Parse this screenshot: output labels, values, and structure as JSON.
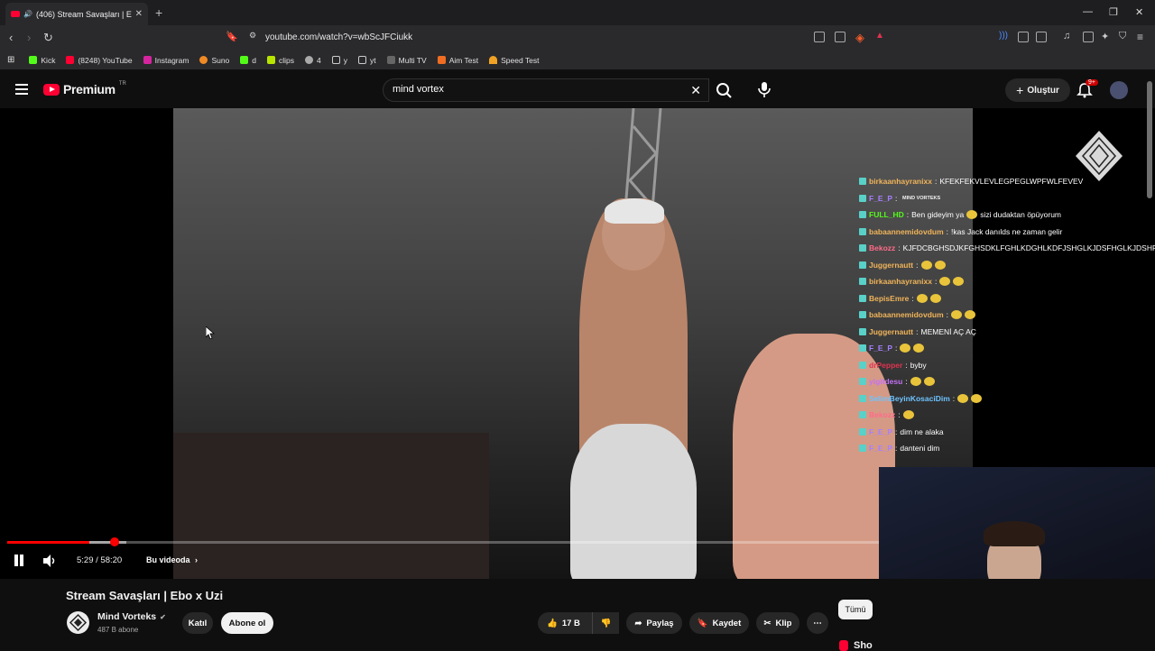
{
  "browser": {
    "tab_title": "(406) Stream Savaşları | Ebo x",
    "url": "youtube.com/watch?v=wbScJFCiukk",
    "bookmarks": [
      {
        "label": "Kick",
        "color": "#53fc18"
      },
      {
        "label": "(8248) YouTube",
        "color": "#ff0033"
      },
      {
        "label": "Instagram",
        "color": "#d6249f"
      },
      {
        "label": "Suno",
        "color": "#f08a24"
      },
      {
        "label": "d",
        "color": "#53fc18"
      },
      {
        "label": "clips",
        "color": "#b7e500"
      },
      {
        "label": "4",
        "color": "#aaaaaa"
      },
      {
        "label": "y",
        "color": "#aaaaaa"
      },
      {
        "label": "yt",
        "color": "#aaaaaa"
      },
      {
        "label": "Multi TV",
        "color": "#888888"
      },
      {
        "label": "Aim Test",
        "color": "#f06d22"
      },
      {
        "label": "Speed Test",
        "color": "#f0a224"
      }
    ]
  },
  "youtube": {
    "logo_text": "Premium",
    "country": "TR",
    "search_value": "mind vortex",
    "create_label": "Oluştur",
    "notif_badge": "9+"
  },
  "player": {
    "time": "5:29 / 58:20",
    "chapter_label": "Bu videoda",
    "progress_fraction": 0.094,
    "overlay_logo_text": "MIND VORTEKS"
  },
  "chat": [
    {
      "user": "birkaanhayranixx",
      "color": "#f0b45a",
      "text": "KFEKFEKVLEVLEGPEGLWPFWLFEVEV",
      "emojis": 0
    },
    {
      "user": "F_E_P",
      "color": "#a67fff",
      "text": "",
      "emojis": 0
    },
    {
      "user": "FULL_HD",
      "color": "#53fc18",
      "text": "Ben gideyim ya",
      "emojis": 1,
      "text2": "sizi dudaktan öpüyorum"
    },
    {
      "user": "babaannemidovdum",
      "color": "#f0b45a",
      "text": "!kas Jack danılds ne zaman gelir",
      "emojis": 0
    },
    {
      "user": "Bekozz",
      "color": "#ff6b8a",
      "text": "KJFDCBGHSDJKFGHSDKLFGHLKDGHLKDFJSHGLKJDSFHGLKJDSHF",
      "emojis": 0
    },
    {
      "user": "Juggernautt",
      "color": "#f0b45a",
      "text": "",
      "emojis": 2
    },
    {
      "user": "birkaanhayranixx",
      "color": "#f0b45a",
      "text": "",
      "emojis": 2
    },
    {
      "user": "BepisEmre",
      "color": "#f0b45a",
      "text": "",
      "emojis": 2
    },
    {
      "user": "babaannemidovdum",
      "color": "#f0b45a",
      "text": "",
      "emojis": 2
    },
    {
      "user": "Juggernautt",
      "color": "#f0b45a",
      "text": "MEMENİ AÇ AÇ",
      "emojis": 0
    },
    {
      "user": "F_E_P",
      "color": "#a67fff",
      "text": "",
      "emojis": 2
    },
    {
      "user": "drPepper",
      "color": "#e0334f",
      "text": "byby",
      "emojis": 0
    },
    {
      "user": "yigitdesu",
      "color": "#c471f5",
      "text": "",
      "emojis": 2
    },
    {
      "user": "SelimBeyinKosaciDim",
      "color": "#6ec3ff",
      "text": "",
      "emojis": 2
    },
    {
      "user": "Bekozz",
      "color": "#ff6b8a",
      "text": "",
      "emojis": 1
    },
    {
      "user": "F_E_P",
      "color": "#a67fff",
      "text": "dim ne alaka",
      "emojis": 0
    },
    {
      "user": "F_E_P",
      "color": "#a67fff",
      "text": "danteni dim",
      "emojis": 0
    }
  ],
  "video": {
    "title": "Stream Savaşları | Ebo x Uzi",
    "channel": "Mind Vorteks",
    "subscribers": "487 B abone",
    "join_label": "Katıl",
    "subscribe_label": "Abone ol",
    "likes": "17 B",
    "share_label": "Paylaş",
    "save_label": "Kaydet",
    "clip_label": "Klip",
    "all_label": "Tümü",
    "shorts_label": "Sho"
  }
}
